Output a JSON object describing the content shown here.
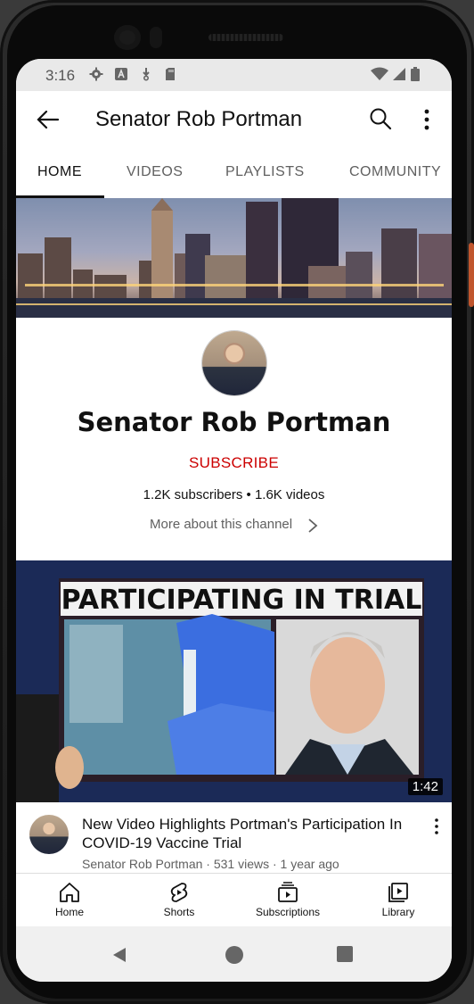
{
  "status_bar": {
    "time": "3:16"
  },
  "app_bar": {
    "title": "Senator Rob Portman"
  },
  "tabs": [
    {
      "label": "HOME",
      "active": true
    },
    {
      "label": "VIDEOS"
    },
    {
      "label": "PLAYLISTS"
    },
    {
      "label": "COMMUNITY"
    }
  ],
  "channel": {
    "name": "Senator Rob Portman",
    "subscribe_label": "SUBSCRIBE",
    "stats": "1.2K subscribers • 1.6K videos",
    "more_about": "More about this channel"
  },
  "video": {
    "thumbnail_headline": "PARTICIPATING IN TRIAL",
    "duration": "1:42",
    "title": "New Video Highlights Portman's Participation In COVID-19 Vaccine Trial",
    "subtitle": "Senator Rob Portman · 531 views · 1 year ago"
  },
  "bottom_nav": [
    {
      "label": "Home",
      "icon": "home-icon"
    },
    {
      "label": "Shorts",
      "icon": "shorts-icon"
    },
    {
      "label": "Subscriptions",
      "icon": "subscriptions-icon"
    },
    {
      "label": "Library",
      "icon": "library-icon"
    }
  ],
  "colors": {
    "subscribe": "#cc0000",
    "accent_text": "#111111",
    "secondary_text": "#606060"
  }
}
